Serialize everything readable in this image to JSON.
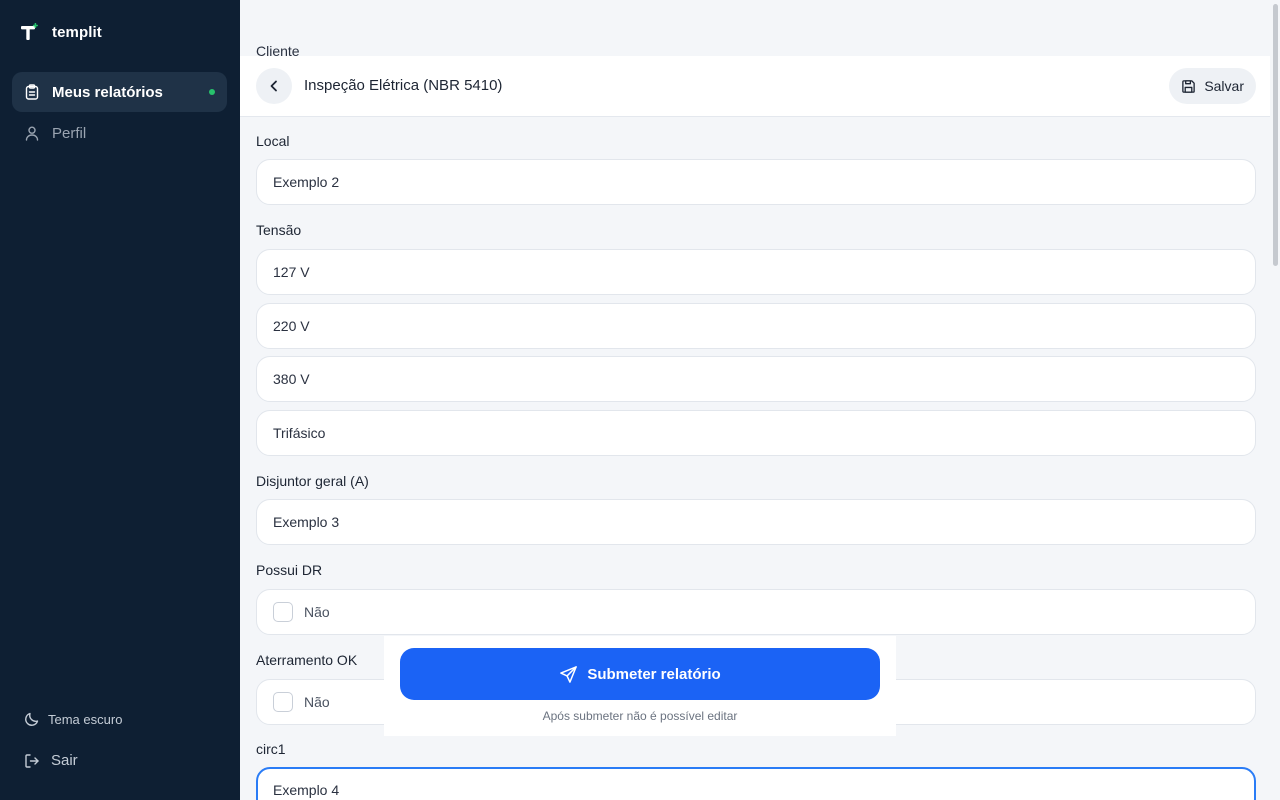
{
  "app": {
    "name": "templit"
  },
  "sidebar": {
    "items": [
      {
        "label": "Meus relatórios",
        "icon": "clipboard-icon",
        "active": true
      },
      {
        "label": "Perfil",
        "icon": "user-icon",
        "active": false
      }
    ],
    "theme_toggle": {
      "label": "Tema escuro",
      "icon": "moon-icon"
    },
    "logout": {
      "label": "Sair",
      "icon": "logout-icon"
    }
  },
  "header": {
    "title": "Inspeção Elétrica (NBR 5410)",
    "save_label": "Salvar",
    "back_icon": "chevron-left-icon",
    "save_icon": "floppy-disk-icon"
  },
  "form": {
    "cut_label": "Cliente",
    "local": {
      "label": "Local",
      "value": "Exemplo 2"
    },
    "tensao": {
      "label": "Tensão",
      "options": [
        "127 V",
        "220 V",
        "380 V",
        "Trifásico"
      ]
    },
    "disjuntor": {
      "label": "Disjuntor geral (A)",
      "value": "Exemplo 3"
    },
    "possui_dr": {
      "label": "Possui DR",
      "value": "Não",
      "checked": false
    },
    "aterramento": {
      "label": "Aterramento OK",
      "value": "Não",
      "checked": false
    },
    "circ1": {
      "label": "circ1",
      "value": "Exemplo 4"
    }
  },
  "submit": {
    "label": "Submeter relatório",
    "note": "Após submeter não é possível editar",
    "icon": "send-icon"
  },
  "colors": {
    "sidebar_bg": "#0e1f33",
    "active_item_bg": "#1f3247",
    "active_dot": "#27c26c",
    "primary": "#1b63f5",
    "focus_border": "#2a7cf6",
    "page_bg": "#f4f6f9"
  }
}
